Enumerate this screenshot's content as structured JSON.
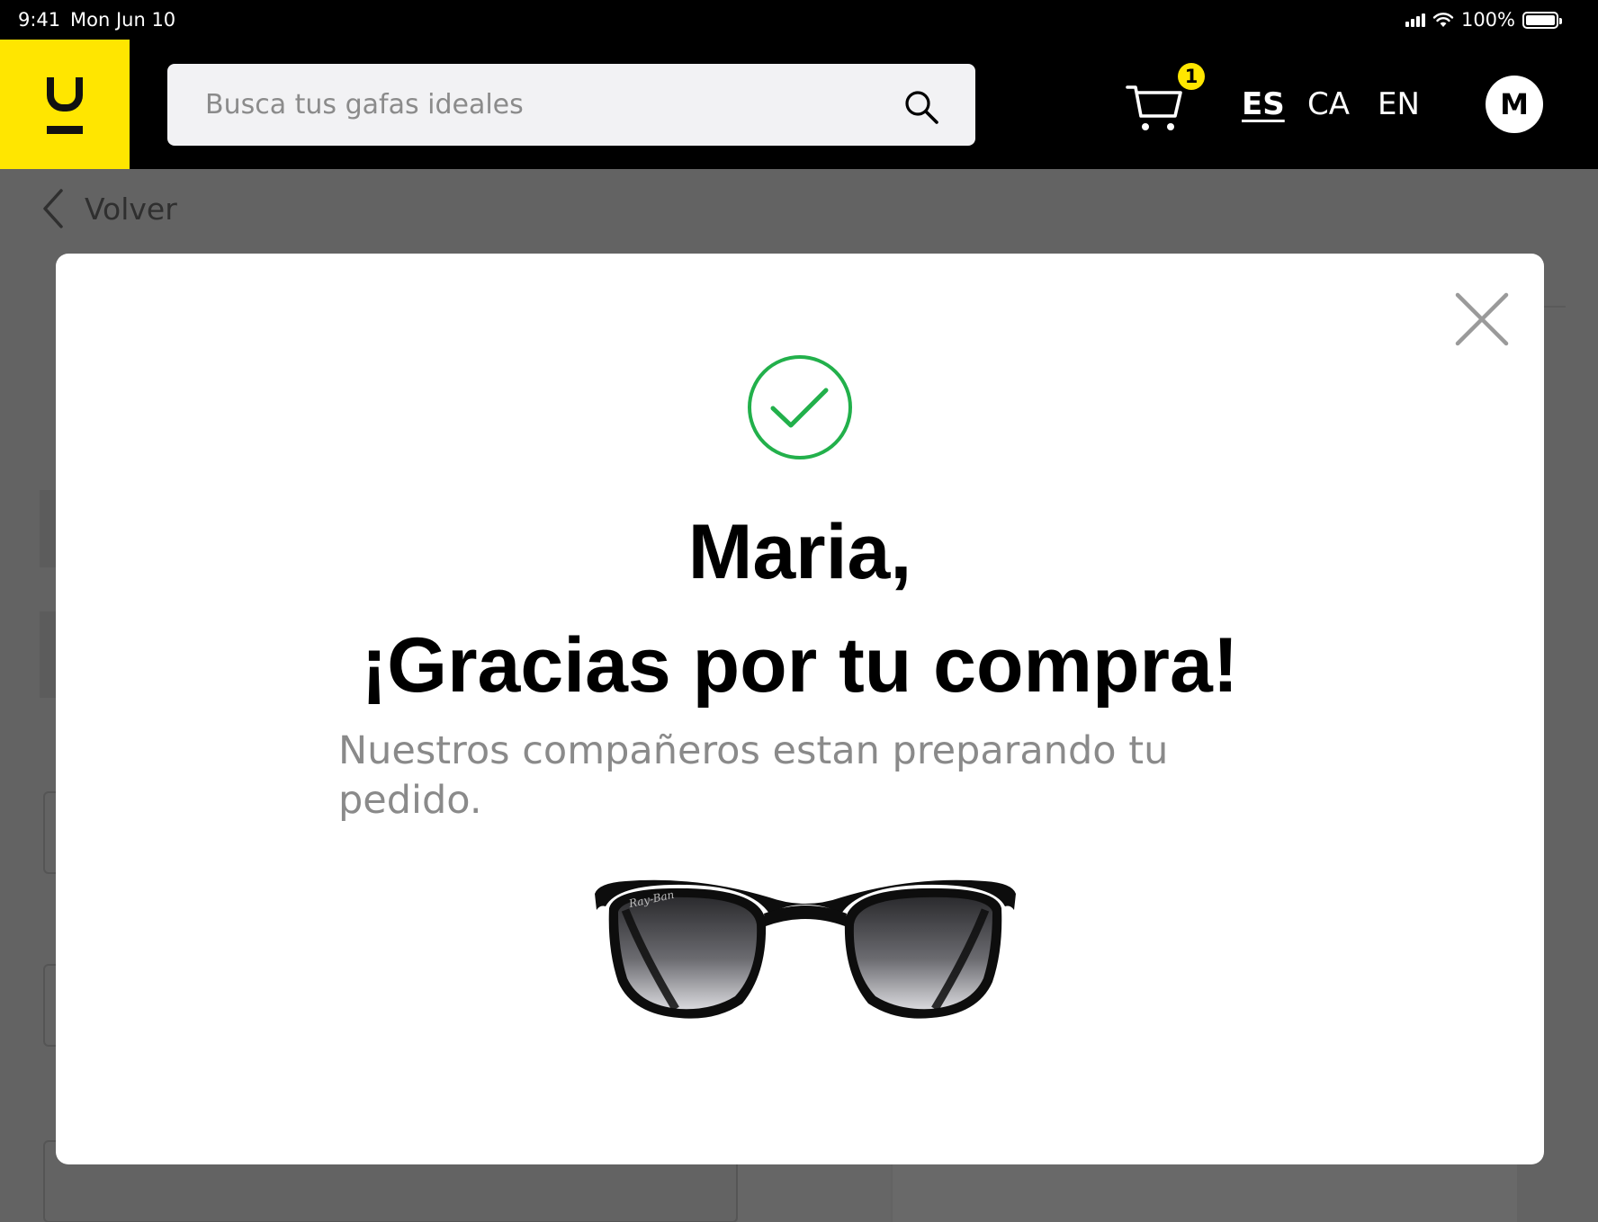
{
  "status_bar": {
    "time": "9:41",
    "date": "Mon Jun 10",
    "battery": "100%",
    "signal_icon": "cellular-signal-icon",
    "wifi_icon": "wifi-icon",
    "battery_icon": "battery-icon"
  },
  "header": {
    "logo_text": "U",
    "search": {
      "placeholder": "Busca tus gafas ideales",
      "value": ""
    },
    "cart_count": "1",
    "languages": [
      {
        "code": "ES",
        "active": true
      },
      {
        "code": "CA",
        "active": false
      },
      {
        "code": "EN",
        "active": false
      }
    ],
    "user_initial": "M"
  },
  "page": {
    "back_label": "Volver"
  },
  "modal": {
    "title_name": "Maria,",
    "title_thanks": "¡Gracias por tu compra!",
    "subtitle": "Nuestros compañeros estan preparando tu pedido.",
    "glasses_brand": "Ray-Ban"
  },
  "colors": {
    "brand_yellow": "#ffe600",
    "success_green": "#22b04b",
    "overlay_grey": "#636363"
  }
}
